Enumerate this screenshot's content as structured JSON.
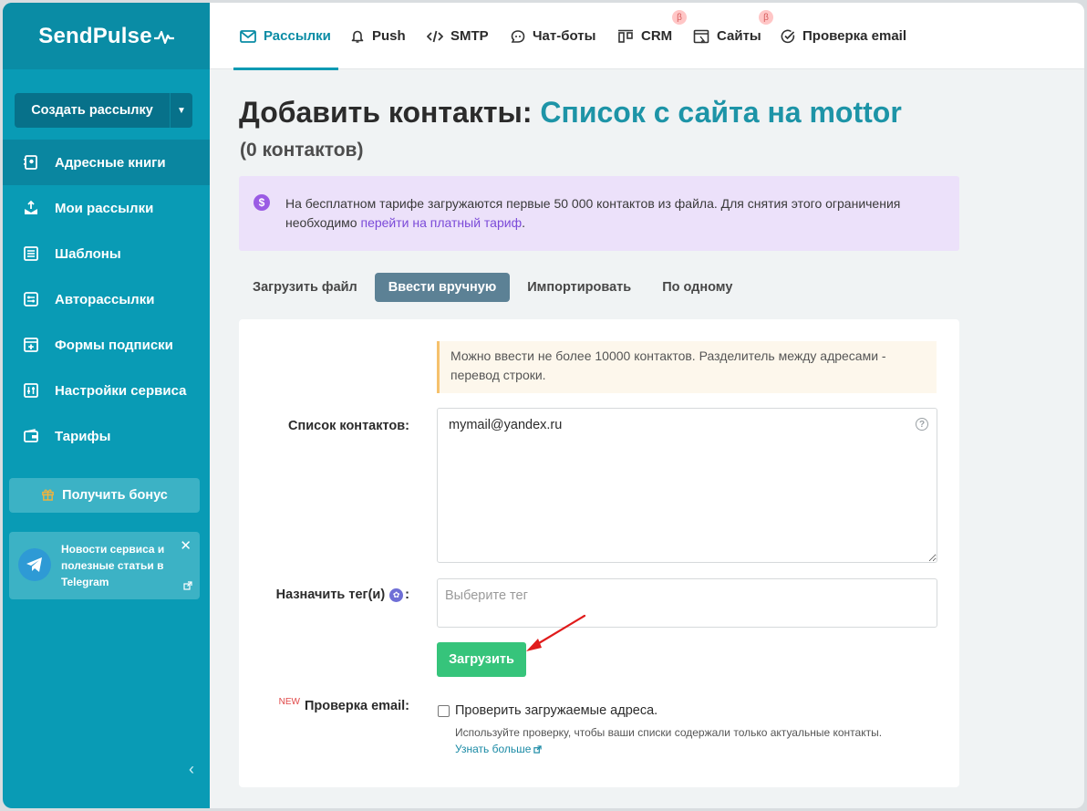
{
  "app": {
    "logo": "SendPulse"
  },
  "sidebar": {
    "create_button": "Создать рассылку",
    "items": [
      {
        "label": "Адресные книги",
        "icon": "address-book-icon",
        "active": true
      },
      {
        "label": "Мои рассылки",
        "icon": "mailings-icon",
        "active": false
      },
      {
        "label": "Шаблоны",
        "icon": "templates-icon",
        "active": false
      },
      {
        "label": "Авторассылки",
        "icon": "automation-icon",
        "active": false
      },
      {
        "label": "Формы подписки",
        "icon": "forms-icon",
        "active": false
      },
      {
        "label": "Настройки сервиса",
        "icon": "settings-icon",
        "active": false
      },
      {
        "label": "Тарифы",
        "icon": "wallet-icon",
        "active": false
      }
    ],
    "bonus_button": "Получить бонус",
    "telegram_card": {
      "text": "Новости сервиса и полезные статьи в Telegram"
    }
  },
  "topnav": {
    "tabs": [
      {
        "label": "Рассылки",
        "icon": "mail-icon",
        "active": true,
        "beta": false
      },
      {
        "label": "Push",
        "icon": "bell-icon",
        "active": false,
        "beta": false
      },
      {
        "label": "SMTP",
        "icon": "code-icon",
        "active": false,
        "beta": false
      },
      {
        "label": "Чат-боты",
        "icon": "chat-icon",
        "active": false,
        "beta": false
      },
      {
        "label": "CRM",
        "icon": "crm-icon",
        "active": false,
        "beta": true
      },
      {
        "label": "Сайты",
        "icon": "site-icon",
        "active": false,
        "beta": true
      },
      {
        "label": "Проверка email",
        "icon": "check-icon",
        "active": false,
        "beta": false
      }
    ],
    "beta_mark": "β"
  },
  "page": {
    "title_prefix": "Добавить контакты:",
    "title_list": "Список с сайта на mottor",
    "subtitle": "(0 контактов)",
    "notice_text": "На бесплатном тарифе загружаются первые 50 000 контактов из файла. Для снятия этого ограничения необходимо",
    "notice_link": "перейти на платный тариф",
    "notice_end": ".",
    "subtabs": [
      "Загрузить файл",
      "Ввести вручную",
      "Импортировать",
      "По одному"
    ],
    "active_subtab": 1
  },
  "form": {
    "hint": "Можно ввести не более 10000 контактов. Разделитель между адресами - перевод строки.",
    "contacts_label": "Список контактов:",
    "contacts_value": "mymail@yandex.ru",
    "tags_label": "Назначить тег(и)",
    "tags_colon": ":",
    "tags_placeholder": "Выберите тег",
    "upload_button": "Загрузить",
    "new_badge": "NEW",
    "verify_label": "Проверка email:",
    "verify_checkbox_label": "Проверить загружаемые адреса.",
    "verify_desc": "Используйте проверку, чтобы ваши списки содержали только актуальные контакты.",
    "verify_link": "Узнать больше"
  },
  "colors": {
    "sidebar": "#099bb5",
    "accent": "#1d94a7",
    "upload_button": "#36c47b",
    "annotation_arrow": "#e01b1b"
  }
}
